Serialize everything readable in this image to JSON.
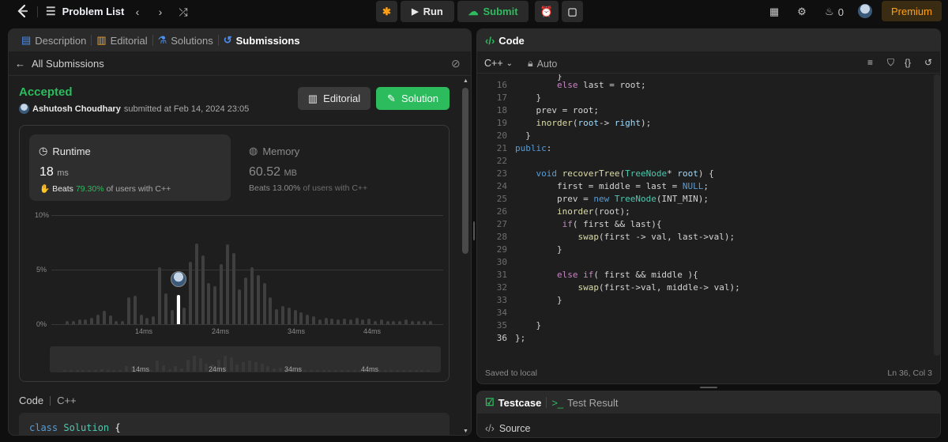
{
  "topbar": {
    "problem_list": "Problem List",
    "run": "Run",
    "submit": "Submit",
    "streak": "0",
    "premium": "Premium"
  },
  "left": {
    "tabs": [
      "Description",
      "Editorial",
      "Solutions",
      "Submissions"
    ],
    "back": "All Submissions",
    "status": "Accepted",
    "user": "Ashutosh Choudhary",
    "submitted_text": "submitted at Feb 14, 2024 23:05",
    "editorial_btn": "Editorial",
    "solution_btn": "Solution",
    "runtime": {
      "label": "Runtime",
      "value": "18",
      "unit": "ms",
      "beats_label": "Beats",
      "beats_pct": "79.30%",
      "beats_suffix": "of users with C++"
    },
    "memory": {
      "label": "Memory",
      "value": "60.52",
      "unit": "MB",
      "beats_label": "Beats",
      "beats_pct": "13.00%",
      "beats_suffix": "of users with C++"
    },
    "code_label": "Code",
    "code_lang": "C++",
    "code_preview": "class Solution {"
  },
  "chart_data": {
    "type": "bar",
    "ytick_labels": [
      "10%",
      "5%",
      "0%"
    ],
    "xtick_labels": [
      "14ms",
      "24ms",
      "34ms",
      "44ms"
    ],
    "ylim": [
      0,
      10
    ],
    "highlight_value": 2.7,
    "values": [
      0.3,
      0.3,
      0.4,
      0.4,
      0.6,
      0.9,
      1.2,
      0.8,
      0.3,
      0.3,
      2.5,
      2.6,
      0.9,
      0.6,
      0.7,
      5.2,
      2.8,
      1.3,
      2.7,
      1.5,
      5.7,
      7.4,
      6.3,
      3.8,
      3.5,
      5.5,
      7.3,
      6.5,
      3.2,
      4.3,
      5.2,
      4.5,
      3.8,
      2.5,
      1.4,
      1.7,
      1.5,
      1.3,
      1.1,
      0.9,
      0.7,
      0.4,
      0.6,
      0.5,
      0.4,
      0.5,
      0.4,
      0.6,
      0.4,
      0.5,
      0.3,
      0.4,
      0.3,
      0.3,
      0.3,
      0.4,
      0.3,
      0.3,
      0.3,
      0.3
    ]
  },
  "right": {
    "title": "Code",
    "lang": "C++",
    "mode": "Auto",
    "saved": "Saved to local",
    "cursor": "Ln 36, Col 3",
    "line_numbers": [
      "16",
      "17",
      "18",
      "19",
      "20",
      "21",
      "22",
      "23",
      "24",
      "25",
      "26",
      "27",
      "28",
      "29",
      "30",
      "31",
      "32",
      "33",
      "34",
      "35",
      "36"
    ],
    "testcase_tab": "Testcase",
    "result_tab": "Test Result",
    "source": "Source"
  }
}
